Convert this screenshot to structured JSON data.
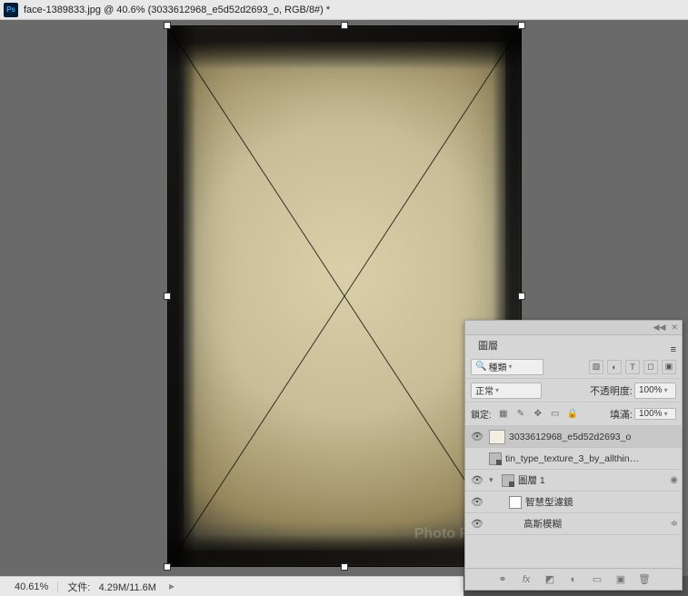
{
  "title_bar": {
    "filename": "face-1389833.jpg",
    "zoom": "40.6%",
    "doc_details": "(3033612968_e5d52d2693_o, RGB/8#) *"
  },
  "status_bar": {
    "zoom": "40.61%",
    "file_label": "文件:",
    "file_size": "4.29M/11.6M"
  },
  "watermark": "Photo Planet",
  "layers_panel": {
    "title": "圖層",
    "search_kind": "種類",
    "blend_mode": "正常",
    "opacity_label": "不透明度:",
    "opacity_value": "100%",
    "lock_label": "鎖定:",
    "fill_label": "填滿:",
    "fill_value": "100%",
    "layers": [
      {
        "name": "3033612968_e5d52d2693_o",
        "visible": true,
        "kind": "pixel",
        "selected": true
      },
      {
        "name": "tin_type_texture_3_by_allthin…",
        "visible": false,
        "kind": "smart",
        "selected": false
      },
      {
        "name": "圖層 1",
        "visible": true,
        "kind": "smart-group",
        "selected": false
      }
    ],
    "filters_label": "智慧型濾鏡",
    "filter_name": "高斯模糊",
    "footer_icons": [
      "link",
      "fx",
      "mask",
      "adj",
      "group",
      "new",
      "trash"
    ]
  }
}
